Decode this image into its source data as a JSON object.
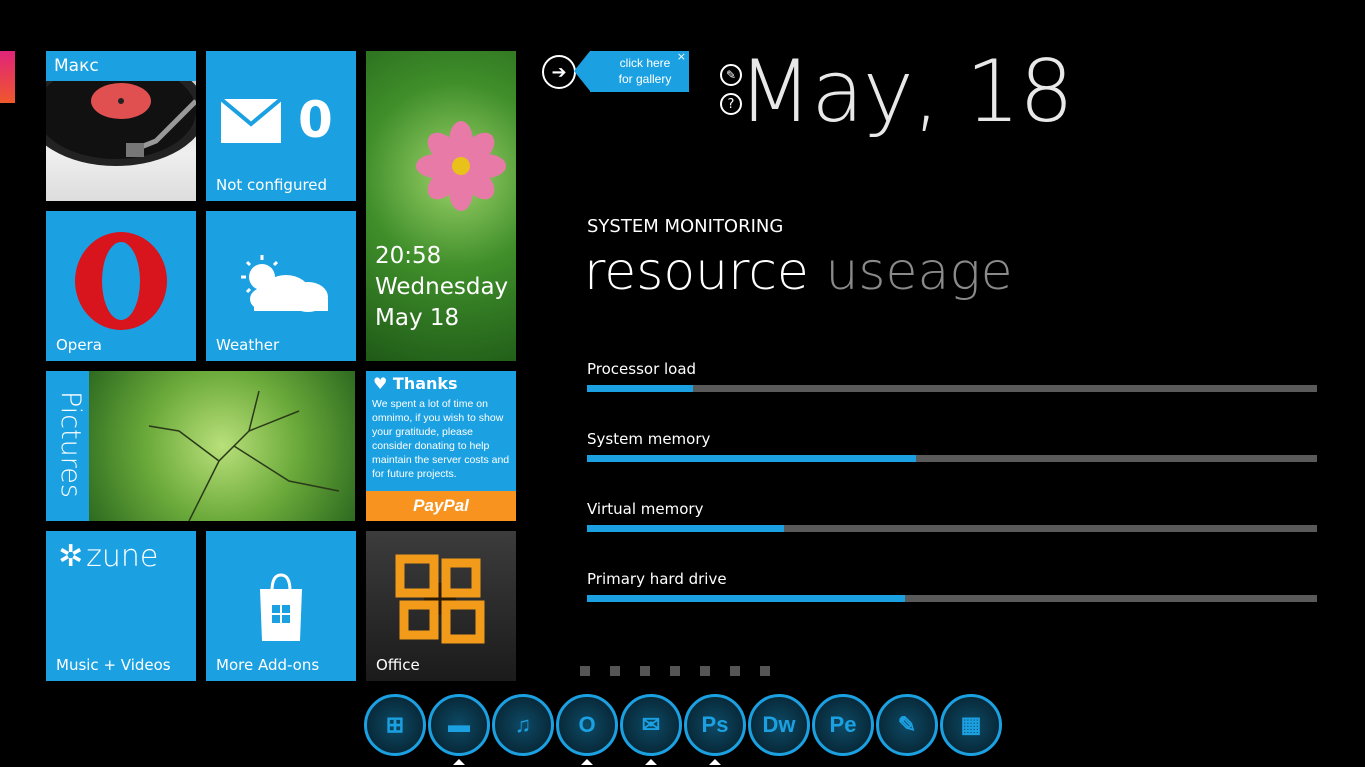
{
  "tiles": {
    "music": {
      "name": "Макс"
    },
    "mail": {
      "count": "0",
      "label": "Not configured"
    },
    "clock": {
      "time": "20:58",
      "day": "Wednesday",
      "date": "May 18"
    },
    "opera": {
      "label": "Opera"
    },
    "weather": {
      "label": "Weather"
    },
    "pictures": {
      "label": "Pictures"
    },
    "thanks": {
      "title": "Thanks",
      "body": "We spent a lot of time on omnimo, if you wish to show your gratitude, please consider donating to help maintain the server costs and for future projects.",
      "paypal": "PayPal"
    },
    "zune": {
      "brand": "zune",
      "label": "Music + Videos"
    },
    "addons": {
      "label": "More Add-ons"
    },
    "office": {
      "label": "Office"
    }
  },
  "gallery": {
    "line1": "click here",
    "line2": "for gallery",
    "close": "×"
  },
  "date": "May, 18",
  "monitor": {
    "title": "SYSTEM MONITORING",
    "heading_main": "resource",
    "heading_sub": "useage",
    "meters": [
      {
        "label": "Processor load",
        "value": 0.145
      },
      {
        "label": "System memory",
        "value": 0.45
      },
      {
        "label": "Virtual memory",
        "value": 0.27
      },
      {
        "label": "Primary hard drive",
        "value": 0.435
      }
    ]
  },
  "pager": {
    "count": 7
  },
  "dock": [
    {
      "name": "windows",
      "glyph": "⊞",
      "running": false
    },
    {
      "name": "explorer",
      "glyph": "▬",
      "running": true
    },
    {
      "name": "music",
      "glyph": "♫",
      "running": false
    },
    {
      "name": "opera",
      "glyph": "O",
      "running": true
    },
    {
      "name": "messenger",
      "glyph": "✉",
      "running": true
    },
    {
      "name": "photoshop",
      "glyph": "Ps",
      "running": true
    },
    {
      "name": "dreamweaver",
      "glyph": "Dw",
      "running": false
    },
    {
      "name": "pe",
      "glyph": "Pe",
      "running": false
    },
    {
      "name": "notepad",
      "glyph": "✎",
      "running": false
    },
    {
      "name": "tiles",
      "glyph": "▦",
      "running": false
    }
  ],
  "colors": {
    "accent": "#1ba1e2",
    "track": "#5a5a5a",
    "paypal": "#f7931e",
    "background": "#000000"
  }
}
